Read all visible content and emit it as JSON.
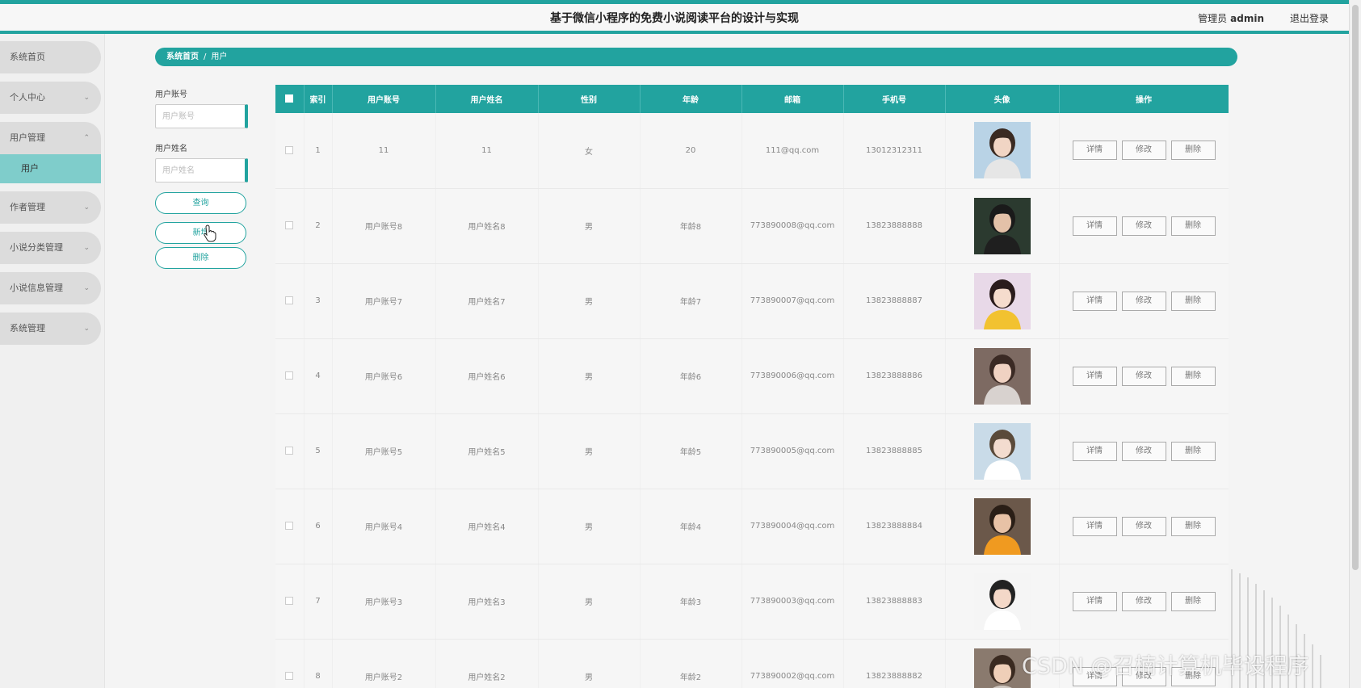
{
  "header": {
    "title": "基于微信小程序的免费小说阅读平台的设计与实现",
    "admin_role": "管理员",
    "admin_name": "admin",
    "logout_label": "退出登录"
  },
  "theme": {
    "accent": "#22a39f",
    "submenu_bg": "#7fcdcb",
    "menu_bg": "#dcdcdc"
  },
  "sidebar": {
    "items": [
      {
        "label": "系统首页",
        "expandable": false
      },
      {
        "label": "个人中心",
        "expandable": true,
        "chevron": "chevron-down-icon"
      },
      {
        "label": "用户管理",
        "expandable": true,
        "open": true,
        "chevron": "chevron-up-icon",
        "children": [
          "用户"
        ]
      },
      {
        "label": "作者管理",
        "expandable": true,
        "chevron": "chevron-down-icon"
      },
      {
        "label": "小说分类管理",
        "expandable": true,
        "chevron": "chevron-down-icon"
      },
      {
        "label": "小说信息管理",
        "expandable": true,
        "chevron": "chevron-down-icon"
      },
      {
        "label": "系统管理",
        "expandable": true,
        "chevron": "chevron-down-icon"
      }
    ],
    "active_sub": "用户"
  },
  "breadcrumb": {
    "home": "系统首页",
    "separator": "/",
    "current": "用户"
  },
  "search": {
    "account_label": "用户账号",
    "account_placeholder": "用户账号",
    "name_label": "用户姓名",
    "name_placeholder": "用户姓名",
    "query_button": "查询",
    "add_button": "新增",
    "delete_button": "删除"
  },
  "table": {
    "columns": [
      "索引",
      "用户账号",
      "用户姓名",
      "性别",
      "年龄",
      "邮箱",
      "手机号",
      "头像",
      "操作"
    ],
    "actions": [
      "详情",
      "修改",
      "删除"
    ],
    "rows": [
      {
        "index": "1",
        "account": "11",
        "name": "11",
        "gender": "女",
        "age": "20",
        "email": "111@qq.com",
        "phone": "13012312311"
      },
      {
        "index": "2",
        "account": "用户账号8",
        "name": "用户姓名8",
        "gender": "男",
        "age": "年龄8",
        "email": "773890008@qq.com",
        "phone": "13823888888"
      },
      {
        "index": "3",
        "account": "用户账号7",
        "name": "用户姓名7",
        "gender": "男",
        "age": "年龄7",
        "email": "773890007@qq.com",
        "phone": "13823888887"
      },
      {
        "index": "4",
        "account": "用户账号6",
        "name": "用户姓名6",
        "gender": "男",
        "age": "年龄6",
        "email": "773890006@qq.com",
        "phone": "13823888886"
      },
      {
        "index": "5",
        "account": "用户账号5",
        "name": "用户姓名5",
        "gender": "男",
        "age": "年龄5",
        "email": "773890005@qq.com",
        "phone": "13823888885"
      },
      {
        "index": "6",
        "account": "用户账号4",
        "name": "用户姓名4",
        "gender": "男",
        "age": "年龄4",
        "email": "773890004@qq.com",
        "phone": "13823888884"
      },
      {
        "index": "7",
        "account": "用户账号3",
        "name": "用户姓名3",
        "gender": "男",
        "age": "年龄3",
        "email": "773890003@qq.com",
        "phone": "13823888883"
      },
      {
        "index": "8",
        "account": "用户账号2",
        "name": "用户姓名2",
        "gender": "男",
        "age": "年龄2",
        "email": "773890002@qq.com",
        "phone": "13823888882"
      }
    ]
  },
  "watermark": "CSDN @召楠计算机毕设程序"
}
